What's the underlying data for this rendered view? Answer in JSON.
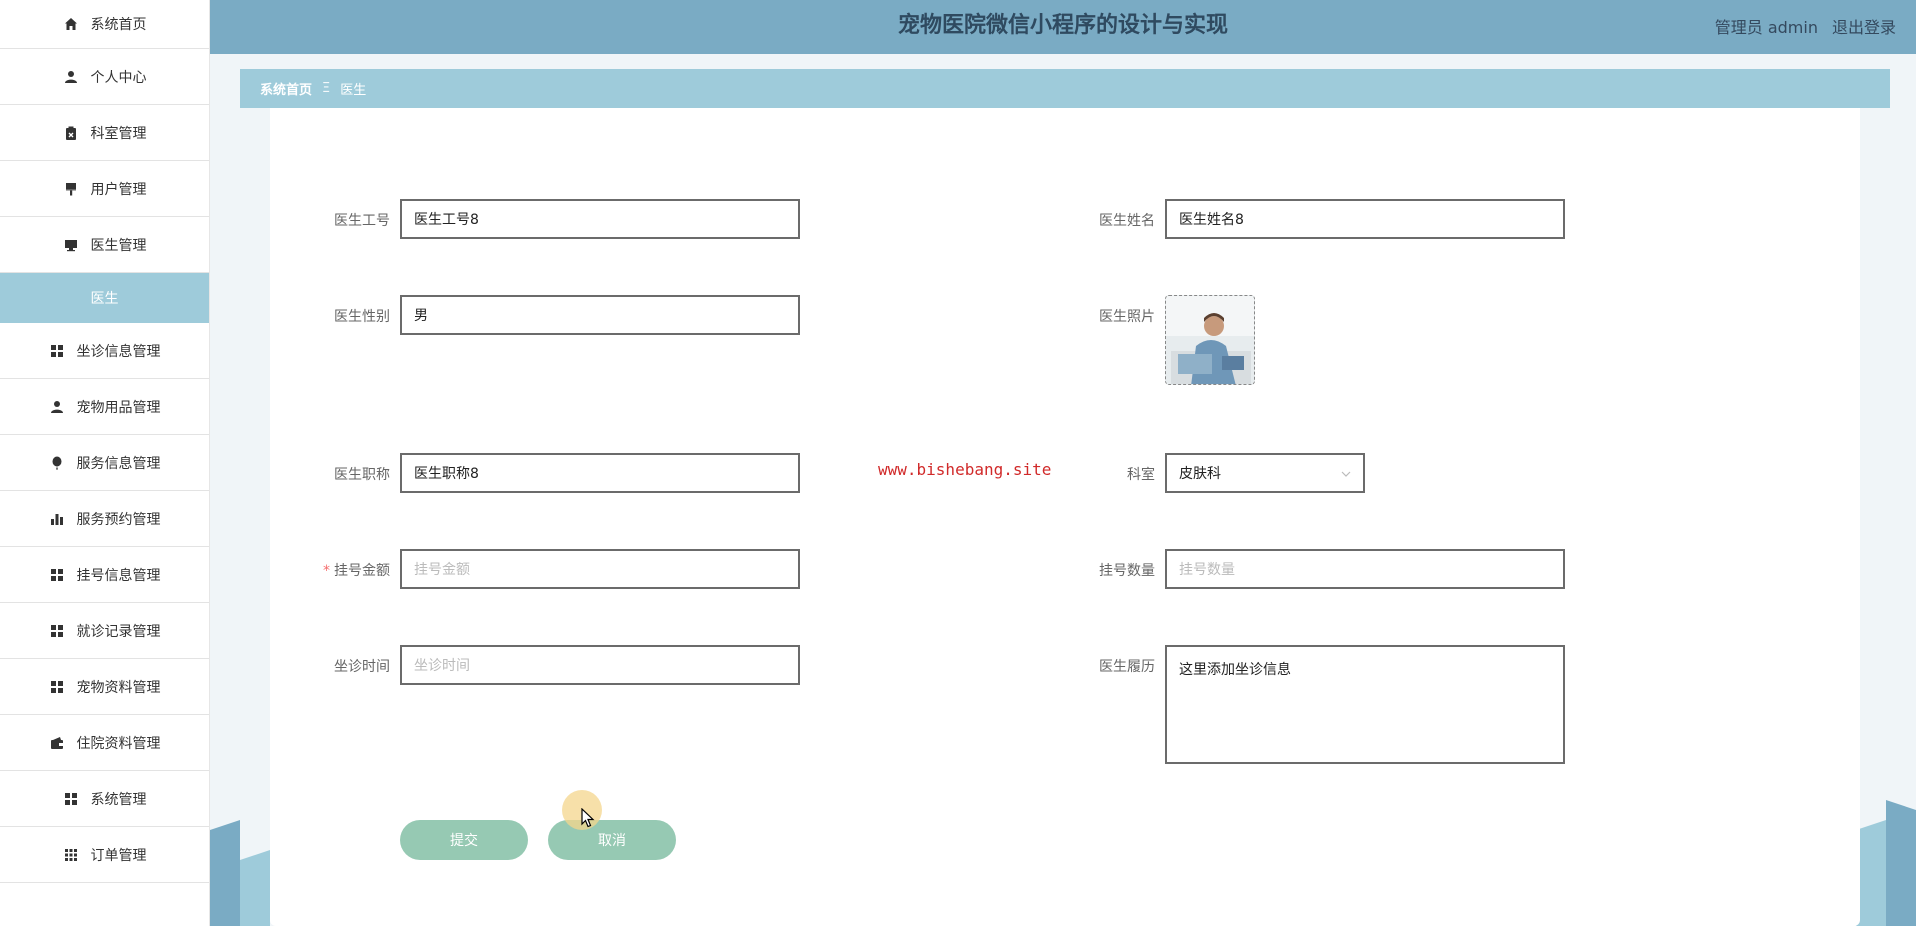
{
  "header": {
    "title": "宠物医院微信小程序的设计与实现",
    "user_label": "管理员 admin",
    "logout_label": "退出登录"
  },
  "sidebar": {
    "items": [
      {
        "label": "系统首页",
        "icon": "home-icon"
      },
      {
        "label": "个人中心",
        "icon": "user-icon"
      },
      {
        "label": "科室管理",
        "icon": "clipboard-icon"
      },
      {
        "label": "用户管理",
        "icon": "brush-icon"
      },
      {
        "label": "医生管理",
        "icon": "monitor-icon"
      },
      {
        "label": "医生",
        "icon": ""
      },
      {
        "label": "坐诊信息管理",
        "icon": "grid-icon"
      },
      {
        "label": "宠物用品管理",
        "icon": "person-icon"
      },
      {
        "label": "服务信息管理",
        "icon": "balloon-icon"
      },
      {
        "label": "服务预约管理",
        "icon": "bar-chart-icon"
      },
      {
        "label": "挂号信息管理",
        "icon": "grid-icon"
      },
      {
        "label": "就诊记录管理",
        "icon": "grid-icon"
      },
      {
        "label": "宠物资料管理",
        "icon": "grid-icon"
      },
      {
        "label": "住院资料管理",
        "icon": "wallet-icon"
      },
      {
        "label": "系统管理",
        "icon": "grid-icon"
      },
      {
        "label": "订单管理",
        "icon": "apps-icon"
      }
    ]
  },
  "breadcrumb": {
    "home": "系统首页",
    "separator": "Ξ",
    "current": "医生"
  },
  "form": {
    "doctor_id": {
      "label": "医生工号",
      "value": "医生工号8"
    },
    "doctor_name": {
      "label": "医生姓名",
      "value": "医生姓名8"
    },
    "gender": {
      "label": "医生性别",
      "value": "男"
    },
    "photo": {
      "label": "医生照片"
    },
    "title": {
      "label": "医生职称",
      "value": "医生职称8"
    },
    "department": {
      "label": "科室",
      "value": "皮肤科"
    },
    "fee": {
      "label": "挂号金额",
      "required_mark": "*",
      "placeholder": "挂号金额"
    },
    "quota": {
      "label": "挂号数量",
      "placeholder": "挂号数量"
    },
    "schedule": {
      "label": "坐诊时间",
      "placeholder": "坐诊时间"
    },
    "resume": {
      "label": "医生履历",
      "value": "这里添加坐诊信息"
    },
    "submit_label": "提交",
    "cancel_label": "取消"
  },
  "watermark": "www.bishebang.site",
  "colors": {
    "header": "#7aabc4",
    "breadcrumb": "#9ecbda",
    "button": "#96c9b3",
    "watermark": "#d12a2a"
  }
}
